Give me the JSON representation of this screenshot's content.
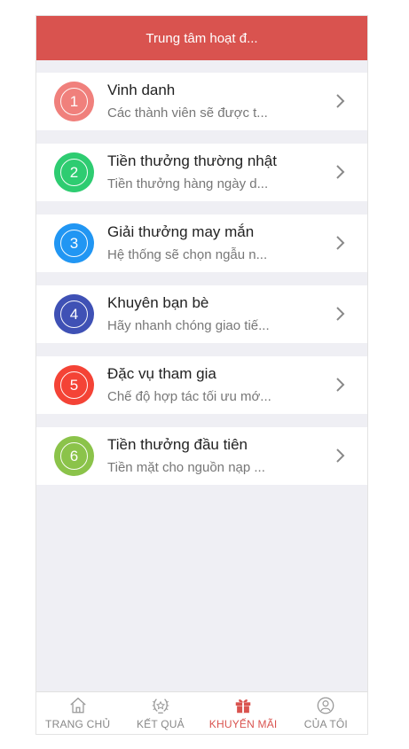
{
  "header": {
    "title": "Trung tâm hoạt đ..."
  },
  "items": [
    {
      "num": "1",
      "color": "#f0807c",
      "title": "Vinh danh",
      "sub": "Các thành viên sẽ được t..."
    },
    {
      "num": "2",
      "color": "#2ecc71",
      "title": "Tiền thưởng thường nhật",
      "sub": "Tiền thưởng hàng ngày d..."
    },
    {
      "num": "3",
      "color": "#2196f3",
      "title": "Giải thưởng may mắn",
      "sub": "Hệ thống sẽ chọn ngẫu n..."
    },
    {
      "num": "4",
      "color": "#3f51b5",
      "title": "Khuyên bạn bè",
      "sub": "Hãy nhanh chóng giao tiế..."
    },
    {
      "num": "5",
      "color": "#f44336",
      "title": "Đặc vụ tham gia",
      "sub": "Chế độ hợp tác tối ưu mớ..."
    },
    {
      "num": "6",
      "color": "#8bc34a",
      "title": "Tiền thưởng đầu tiên",
      "sub": "Tiền mặt cho nguồn nạp ..."
    }
  ],
  "tabs": [
    {
      "label": "TRANG CHỦ",
      "icon": "home-icon"
    },
    {
      "label": "KẾT QUẢ",
      "icon": "laurel-icon"
    },
    {
      "label": "KHUYẾN MÃI",
      "icon": "gift-icon",
      "active": true
    },
    {
      "label": "CỦA TÔI",
      "icon": "user-icon"
    }
  ],
  "colors": {
    "accent": "#d9534f",
    "background": "#efeff4"
  }
}
